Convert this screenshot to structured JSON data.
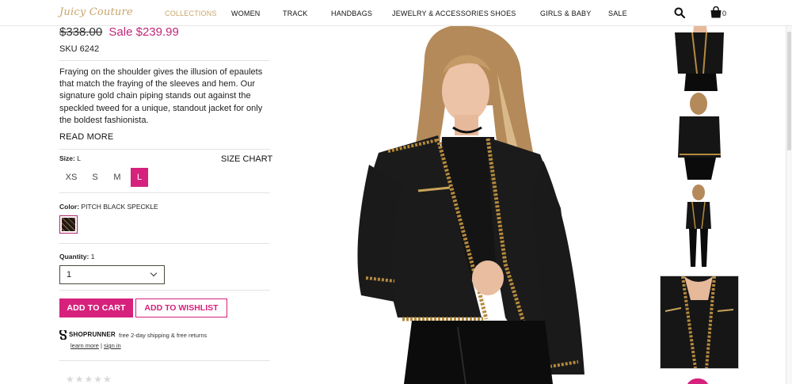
{
  "nav": {
    "logo": "Juicy Couture",
    "items": [
      "COLLECTIONS",
      "WOMEN",
      "TRACK",
      "HANDBAGS",
      "JEWELRY & ACCESSORIES",
      "SHOES",
      "GIRLS & BABY",
      "SALE"
    ],
    "active_index": 0,
    "bag_count": "0",
    "icons": {
      "search": "search-icon",
      "bag": "shopping-bag-icon"
    }
  },
  "product": {
    "price_original": "$338.00",
    "price_sale": "Sale $239.99",
    "sku": "SKU 6242",
    "description": "Fraying on the shoulder gives the illusion of epaulets that match the fraying of the sleeves and hem. Our signature gold chain piping stands out against the speckled tweed for a unique, standout jacket for only the boldest fashionista.",
    "read_more": "READ MORE",
    "size_label": "Size:",
    "size_value": "L",
    "size_chart": "SIZE CHART",
    "sizes": [
      "XS",
      "S",
      "M",
      "L"
    ],
    "selected_size": "L",
    "color_label": "Color:",
    "color_value": "PITCH BLACK SPECKLE",
    "quantity_label": "Quantity:",
    "quantity_value": "1",
    "add_to_cart": "ADD TO CART",
    "add_to_wishlist": "ADD TO WISHLIST",
    "rating": 0
  },
  "shoprunner": {
    "brand": "SHOPRUNNER",
    "text": "free 2-day shipping & free returns",
    "learn_more": "learn more",
    "separator": " | ",
    "sign_in": "sign in"
  },
  "colors": {
    "accent": "#d6217d",
    "sale": "#c0267a",
    "gold": "#c7a46b"
  }
}
